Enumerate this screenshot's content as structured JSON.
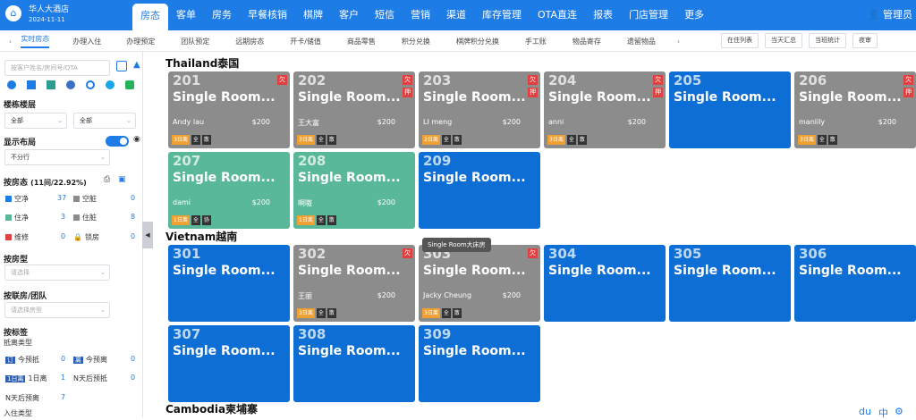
{
  "header": {
    "hotel_name": "华人大酒店",
    "date": "2024-11-11",
    "logo_icon": "hotel-logo-icon",
    "nav": [
      "房态",
      "客单",
      "房务",
      "早餐核销",
      "棋牌",
      "客户",
      "短信",
      "营销",
      "渠道",
      "库存管理",
      "OTA直连",
      "报表",
      "门店管理",
      "更多"
    ],
    "user": "管理员"
  },
  "subnav": {
    "tabs": [
      "实时房态",
      "办理入住",
      "办理预定",
      "团队预定",
      "远期房态",
      "开卡/储值",
      "商品零售",
      "积分兑换",
      "棋牌积分兑换",
      "手工账",
      "物品寄存",
      "遗留物品"
    ],
    "buttons": [
      "在住列表",
      "当天汇总",
      "当班统计",
      "夜审"
    ]
  },
  "sidebar": {
    "search_placeholder": "按客户姓名/房间号/OTA",
    "building_heading": "楼栋楼层",
    "building_select": "全部",
    "floor_select": "全部",
    "layout_heading": "显示布局",
    "layout_select": "不分行",
    "status_heading": "按房态",
    "status_count": "(11间/22.92%)",
    "statuses": [
      {
        "label": "空净",
        "count": "37",
        "color": "#1e7ce6"
      },
      {
        "label": "空脏",
        "count": "0",
        "color": "#8c8c8c"
      },
      {
        "label": "住净",
        "count": "3",
        "color": "#59b89a"
      },
      {
        "label": "住脏",
        "count": "8",
        "color": "#8c8c8c"
      },
      {
        "label": "维修",
        "count": "0",
        "color": "#e04040"
      },
      {
        "label": "锁房",
        "count": "0",
        "color": "#e04040"
      }
    ],
    "roomtype_heading": "按房型",
    "roomtype_placeholder": "请选择",
    "joint_heading": "按联房/团队",
    "joint_placeholder": "请选择房型",
    "tag_heading": "按标签",
    "arrival_type": "抵离类型",
    "tags": [
      {
        "badge": "订",
        "label": "今预抵",
        "count": "0"
      },
      {
        "badge": "离",
        "label": "今预离",
        "count": "0"
      },
      {
        "badge": "1日离",
        "label": "1日离",
        "count": "1"
      },
      {
        "badge": "",
        "label": "N天后预抵",
        "count": "0"
      },
      {
        "badge": "",
        "label": "N天后预离",
        "count": "7"
      }
    ],
    "checkin_type": "入住类型"
  },
  "floors": [
    {
      "name": "Thailand泰国",
      "rooms": [
        {
          "num": "201",
          "type": "Single Room...",
          "guest": "Andy lau",
          "price": "$200",
          "status": "gray",
          "badges": [
            "欠"
          ],
          "tags": [
            "3日离",
            "全",
            "散"
          ]
        },
        {
          "num": "202",
          "type": "Single Room...",
          "guest": "王大富",
          "price": "$200",
          "status": "gray",
          "badges": [
            "欠",
            "押"
          ],
          "tags": [
            "3日离",
            "全",
            "散"
          ]
        },
        {
          "num": "203",
          "type": "Single Room...",
          "guest": "LI meng",
          "price": "$200",
          "status": "gray",
          "badges": [
            "欠",
            "押"
          ],
          "tags": [
            "2日离",
            "全",
            "散"
          ]
        },
        {
          "num": "204",
          "type": "Single Room...",
          "guest": "anni",
          "price": "$200",
          "status": "gray",
          "badges": [
            "欠",
            "押"
          ],
          "tags": [
            "3日离",
            "全",
            "散"
          ]
        },
        {
          "num": "205",
          "type": "Single Room...",
          "guest": "",
          "price": "",
          "status": "blue",
          "badges": [],
          "tags": []
        },
        {
          "num": "206",
          "type": "Single Room...",
          "guest": "manlily",
          "price": "$200",
          "status": "gray",
          "badges": [
            "欠",
            "押"
          ],
          "tags": [
            "3日离",
            "全",
            "散"
          ]
        },
        {
          "num": "207",
          "type": "Single Room...",
          "guest": "dami",
          "price": "$200",
          "status": "green",
          "badges": [],
          "tags": [
            "1日离",
            "全",
            "协"
          ]
        },
        {
          "num": "208",
          "type": "Single Room...",
          "guest": "啊嗷",
          "price": "$200",
          "status": "green",
          "badges": [],
          "tags": [
            "1日离",
            "全",
            "散"
          ]
        },
        {
          "num": "209",
          "type": "Single Room...",
          "guest": "",
          "price": "",
          "status": "blue",
          "badges": [],
          "tags": []
        }
      ]
    },
    {
      "name": "Vietnam越南",
      "rooms": [
        {
          "num": "301",
          "type": "Single Room...",
          "guest": "",
          "price": "",
          "status": "blue",
          "badges": [],
          "tags": []
        },
        {
          "num": "302",
          "type": "Single Room...",
          "guest": "王丽",
          "price": "$200",
          "status": "gray",
          "badges": [
            "欠"
          ],
          "tags": [
            "3日离",
            "全",
            "散"
          ]
        },
        {
          "num": "303",
          "type": "Single Room...",
          "guest": "Jacky Cheung",
          "price": "$200",
          "status": "gray",
          "badges": [
            "欠"
          ],
          "tags": [
            "3日离",
            "全",
            "散"
          ]
        },
        {
          "num": "304",
          "type": "Single Room...",
          "guest": "",
          "price": "",
          "status": "blue",
          "badges": [],
          "tags": []
        },
        {
          "num": "305",
          "type": "Single Room...",
          "guest": "",
          "price": "",
          "status": "blue",
          "badges": [],
          "tags": []
        },
        {
          "num": "306",
          "type": "Single Room...",
          "guest": "",
          "price": "",
          "status": "blue",
          "badges": [],
          "tags": []
        },
        {
          "num": "307",
          "type": "Single Room...",
          "guest": "",
          "price": "",
          "status": "blue",
          "badges": [],
          "tags": []
        },
        {
          "num": "308",
          "type": "Single Room...",
          "guest": "",
          "price": "",
          "status": "blue",
          "badges": [],
          "tags": []
        },
        {
          "num": "309",
          "type": "Single Room...",
          "guest": "",
          "price": "",
          "status": "blue",
          "badges": [],
          "tags": []
        }
      ]
    },
    {
      "name": "Cambodia柬埔寨",
      "rooms": []
    }
  ],
  "tooltip": "Single Room大床房",
  "bottom_right": [
    "du",
    "中"
  ]
}
